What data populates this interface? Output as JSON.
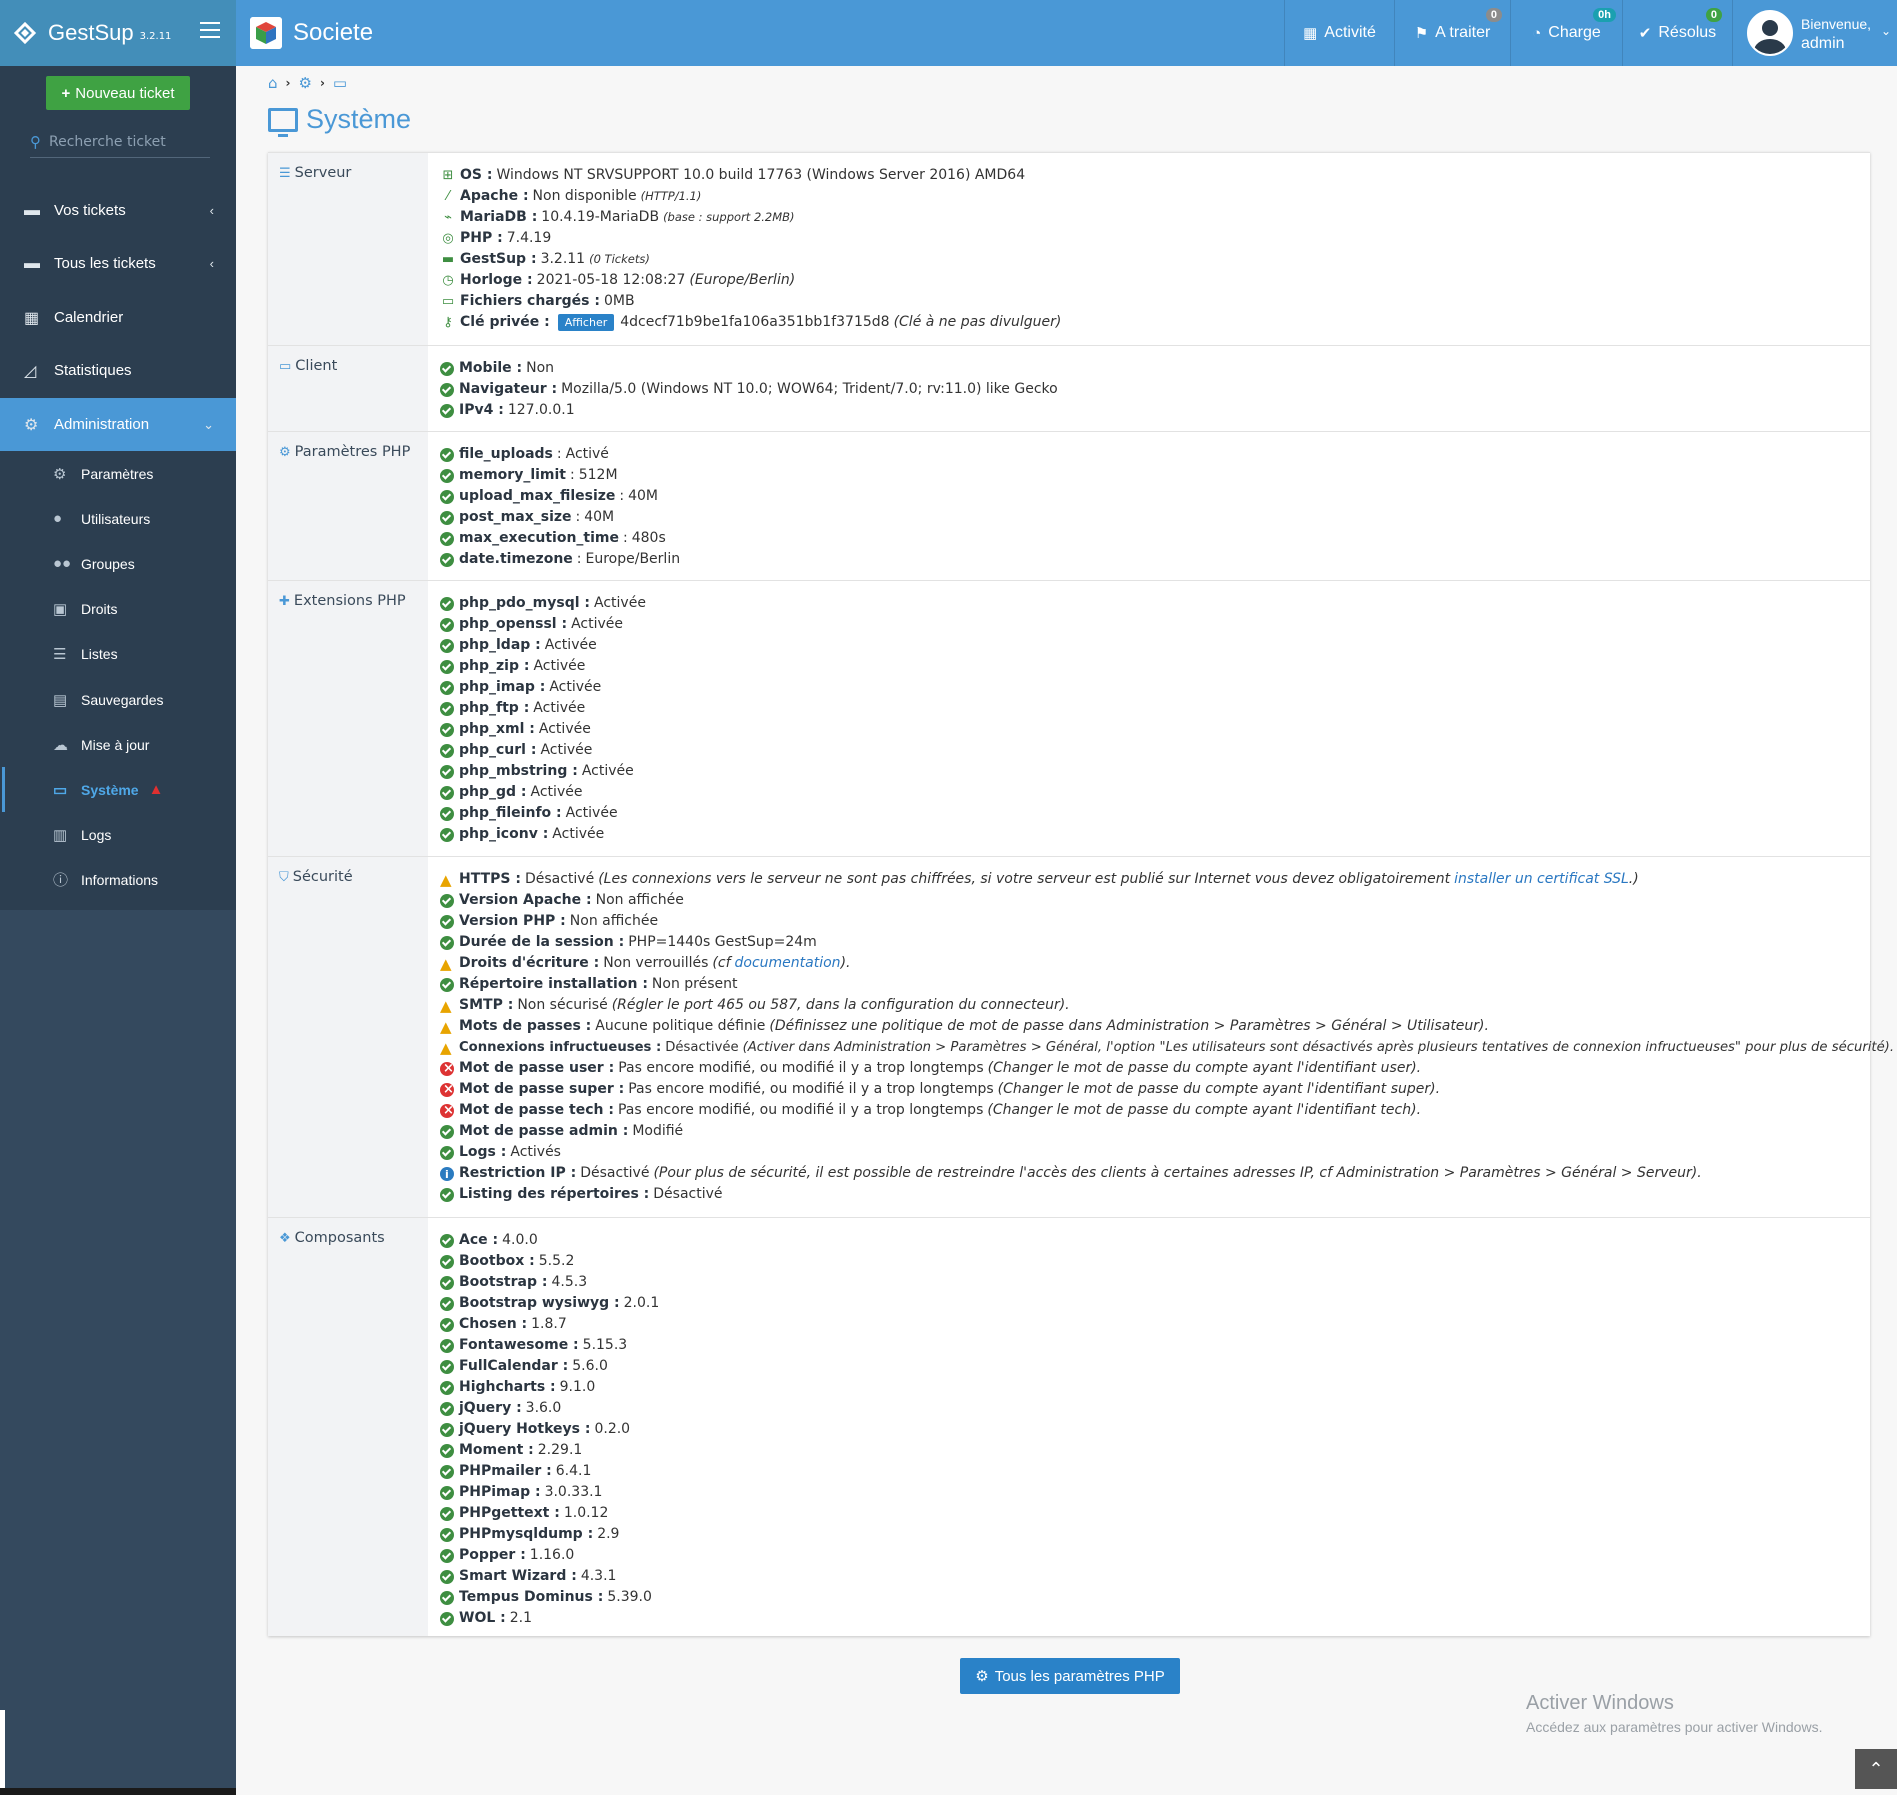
{
  "brand": {
    "name": "GestSup",
    "version": "3.2.11"
  },
  "header": {
    "company": "Societe",
    "nav": [
      {
        "label": "Activité",
        "badge": ""
      },
      {
        "label": "A traiter",
        "badge": "0"
      },
      {
        "label": "Charge",
        "badge": "0h"
      },
      {
        "label": "Résolus",
        "badge": "0"
      }
    ],
    "user": {
      "welcome": "Bienvenue,",
      "name": "admin"
    }
  },
  "colors": {
    "accent": "#4a98d6",
    "success": "#3fa243",
    "warning": "#e8a400",
    "danger": "#dd3333"
  },
  "sidebar": {
    "new_ticket": "Nouveau ticket",
    "search_placeholder": "Recherche ticket",
    "items": [
      {
        "label": "Vos tickets",
        "icon": "ticket-icon"
      },
      {
        "label": "Tous les tickets",
        "icon": "ticket-icon"
      },
      {
        "label": "Calendrier",
        "icon": "calendar-icon"
      },
      {
        "label": "Statistiques",
        "icon": "chart-icon"
      },
      {
        "label": "Administration",
        "icon": "gears-icon"
      }
    ],
    "sub_items": [
      "Paramètres",
      "Utilisateurs",
      "Groupes",
      "Droits",
      "Listes",
      "Sauvegardes",
      "Mise à jour",
      "Système",
      "Logs",
      "Informations"
    ]
  },
  "page": {
    "title": "Système",
    "all_php_button": "Tous les paramètres PHP"
  },
  "sections": {
    "serveur": {
      "label": "Serveur",
      "os_k": "OS :",
      "os_v": "Windows NT SRVSUPPORT 10.0 build 17763 (Windows Server 2016) AMD64",
      "apache_k": "Apache :",
      "apache_v": "Non disponible",
      "apache_n": "(HTTP/1.1)",
      "db_k": "MariaDB :",
      "db_v": "10.4.19-MariaDB",
      "db_n": "(base : support 2.2MB)",
      "php_k": "PHP :",
      "php_v": "7.4.19",
      "gs_k": "GestSup :",
      "gs_v": "3.2.11",
      "gs_n": "(0 Tickets)",
      "clock_k": "Horloge :",
      "clock_v": "2021-05-18 12:08:27",
      "clock_n": "(Europe/Berlin)",
      "files_k": "Fichiers chargés :",
      "files_v": "0MB",
      "key_k": "Clé privée :",
      "key_btn": "Afficher",
      "key_v": "4dcecf71b9be1fa106a351bb1f3715d8",
      "key_n": "(Clé à ne pas divulguer)"
    },
    "client": {
      "label": "Client",
      "rows": [
        [
          "Mobile :",
          "Non"
        ],
        [
          "Navigateur :",
          "Mozilla/5.0 (Windows NT 10.0; WOW64; Trident/7.0; rv:11.0) like Gecko"
        ],
        [
          "IPv4 :",
          "127.0.0.1"
        ]
      ]
    },
    "php_params": {
      "label": "Paramètres PHP",
      "rows": [
        [
          "file_uploads",
          "Activé"
        ],
        [
          "memory_limit",
          "512M"
        ],
        [
          "upload_max_filesize",
          "40M"
        ],
        [
          "post_max_size",
          "40M"
        ],
        [
          "max_execution_time",
          "480s"
        ],
        [
          "date.timezone",
          "Europe/Berlin"
        ]
      ]
    },
    "php_ext": {
      "label": "Extensions PHP",
      "rows": [
        [
          "php_pdo_mysql :",
          "Activée"
        ],
        [
          "php_openssl :",
          "Activée"
        ],
        [
          "php_ldap :",
          "Activée"
        ],
        [
          "php_zip :",
          "Activée"
        ],
        [
          "php_imap :",
          "Activée"
        ],
        [
          "php_ftp :",
          "Activée"
        ],
        [
          "php_xml :",
          "Activée"
        ],
        [
          "php_curl :",
          "Activée"
        ],
        [
          "php_mbstring :",
          "Activée"
        ],
        [
          "php_gd :",
          "Activée"
        ],
        [
          "php_fileinfo :",
          "Activée"
        ],
        [
          "php_iconv :",
          "Activée"
        ]
      ]
    },
    "securite": {
      "label": "Sécurité",
      "https_k": "HTTPS :",
      "https_v": "Désactivé",
      "https_n": "(Les connexions vers le serveur ne sont pas chiffrées, si votre serveur est publié sur Internet vous devez obligatoirement",
      "https_link": "installer un certificat SSL",
      "https_end": ".)",
      "va_k": "Version Apache :",
      "va_v": "Non affichée",
      "vp_k": "Version PHP :",
      "vp_v": "Non affichée",
      "sess_k": "Durée de la session :",
      "sess_v": "PHP=1440s GestSup=24m",
      "dw_k": "Droits d'écriture :",
      "dw_v": "Non verrouillés",
      "dw_n1": "(cf",
      "dw_link": "documentation",
      "dw_n2": ").",
      "ri_k": "Répertoire installation :",
      "ri_v": "Non présent",
      "smtp_k": "SMTP :",
      "smtp_v": "Non sécurisé",
      "smtp_n": "(Régler le port 465 ou 587, dans la configuration du connecteur).",
      "mp_k": "Mots de passes :",
      "mp_v": "Aucune politique définie",
      "mp_n": "(Définissez une politique de mot de passe dans Administration > Paramètres > Général > Utilisateur).",
      "ci_k": "Connexions infructueuses :",
      "ci_v": "Désactivée",
      "ci_n": "(Activer dans Administration > Paramètres > Général, l'option \"Les utilisateurs sont désactivés après plusieurs tentatives de connexion infructueuses\" pour plus de sécurité).",
      "pu_k": "Mot de passe user :",
      "pu_v": "Pas encore modifié, ou modifié il y a trop longtemps",
      "pu_n": "(Changer le mot de passe du compte ayant l'identifiant user).",
      "ps_k": "Mot de passe super :",
      "ps_v": "Pas encore modifié, ou modifié il y a trop longtemps",
      "ps_n": "(Changer le mot de passe du compte ayant l'identifiant super).",
      "pt_k": "Mot de passe tech :",
      "pt_v": "Pas encore modifié, ou modifié il y a trop longtemps",
      "pt_n": "(Changer le mot de passe du compte ayant l'identifiant tech).",
      "pa_k": "Mot de passe admin :",
      "pa_v": "Modifié",
      "lg_k": "Logs :",
      "lg_v": "Activés",
      "ip_k": "Restriction IP :",
      "ip_v": "Désactivé",
      "ip_n": "(Pour plus de sécurité, il est possible de restreindre l'accès des clients à certaines adresses IP, cf Administration > Paramètres > Général > Serveur).",
      "ld_k": "Listing des répertoires :",
      "ld_v": "Désactivé"
    },
    "composants": {
      "label": "Composants",
      "rows": [
        [
          "Ace :",
          "4.0.0"
        ],
        [
          "Bootbox :",
          "5.5.2"
        ],
        [
          "Bootstrap :",
          "4.5.3"
        ],
        [
          "Bootstrap wysiwyg :",
          "2.0.1"
        ],
        [
          "Chosen :",
          "1.8.7"
        ],
        [
          "Fontawesome :",
          "5.15.3"
        ],
        [
          "FullCalendar :",
          "5.6.0"
        ],
        [
          "Highcharts :",
          "9.1.0"
        ],
        [
          "jQuery :",
          "3.6.0"
        ],
        [
          "jQuery Hotkeys :",
          "0.2.0"
        ],
        [
          "Moment :",
          "2.29.1"
        ],
        [
          "PHPmailer :",
          "6.4.1"
        ],
        [
          "PHPimap :",
          "3.0.33.1"
        ],
        [
          "PHPgettext :",
          "1.0.12"
        ],
        [
          "PHPmysqldump :",
          "2.9"
        ],
        [
          "Popper :",
          "1.16.0"
        ],
        [
          "Smart Wizard :",
          "4.3.1"
        ],
        [
          "Tempus Dominus :",
          "5.39.0"
        ],
        [
          "WOL :",
          "2.1"
        ]
      ]
    }
  },
  "watermark": {
    "line1": "Activer Windows",
    "line2": "Accédez aux paramètres pour activer Windows."
  }
}
